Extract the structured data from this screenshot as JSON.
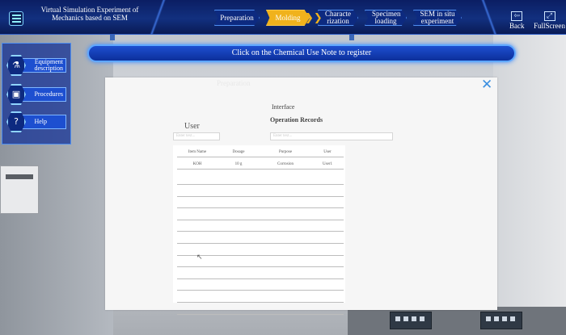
{
  "header": {
    "title": "Virtual Simulation Experiment of Mechanics based on SEM",
    "steps": [
      {
        "label": "Preparation",
        "active": false
      },
      {
        "label": "Molding",
        "active": true
      },
      {
        "label": "Characterization",
        "active": false
      },
      {
        "label": "Specimen loading",
        "active": false
      },
      {
        "label": "SEM in situ experiment",
        "active": false
      }
    ],
    "back_label": "Back",
    "fullscreen_label": "FullScreen",
    "back_icon": "back-icon",
    "fullscreen_icon": "fullscreen-icon",
    "menu_icon": "menu-icon"
  },
  "banner": {
    "text": "Click on the Chemical Use Note to register"
  },
  "sidebar": {
    "items": [
      {
        "label": "Equipment description",
        "icon": "flask-icon"
      },
      {
        "label": "Procedures",
        "icon": "save-icon"
      },
      {
        "label": "Help",
        "icon": "question-icon"
      }
    ]
  },
  "modal": {
    "ghost_title": "Preparation",
    "interface_label": "Interface",
    "records_title": "Operation Records",
    "user_label": "User",
    "user_input_placeholder": "Enter text...",
    "records_input_placeholder": "Enter text...",
    "table": {
      "columns": [
        "Item Name",
        "Dosage",
        "Purpose",
        "User"
      ],
      "rows": [
        [
          "KOH",
          "10 g",
          "Corrosion",
          "User1"
        ]
      ],
      "empty_rows": 12
    }
  },
  "colors": {
    "topbar": "#12307f",
    "active_step": "#f0b21c",
    "banner": "#1d4fd0",
    "close": "#3b8fe0"
  }
}
